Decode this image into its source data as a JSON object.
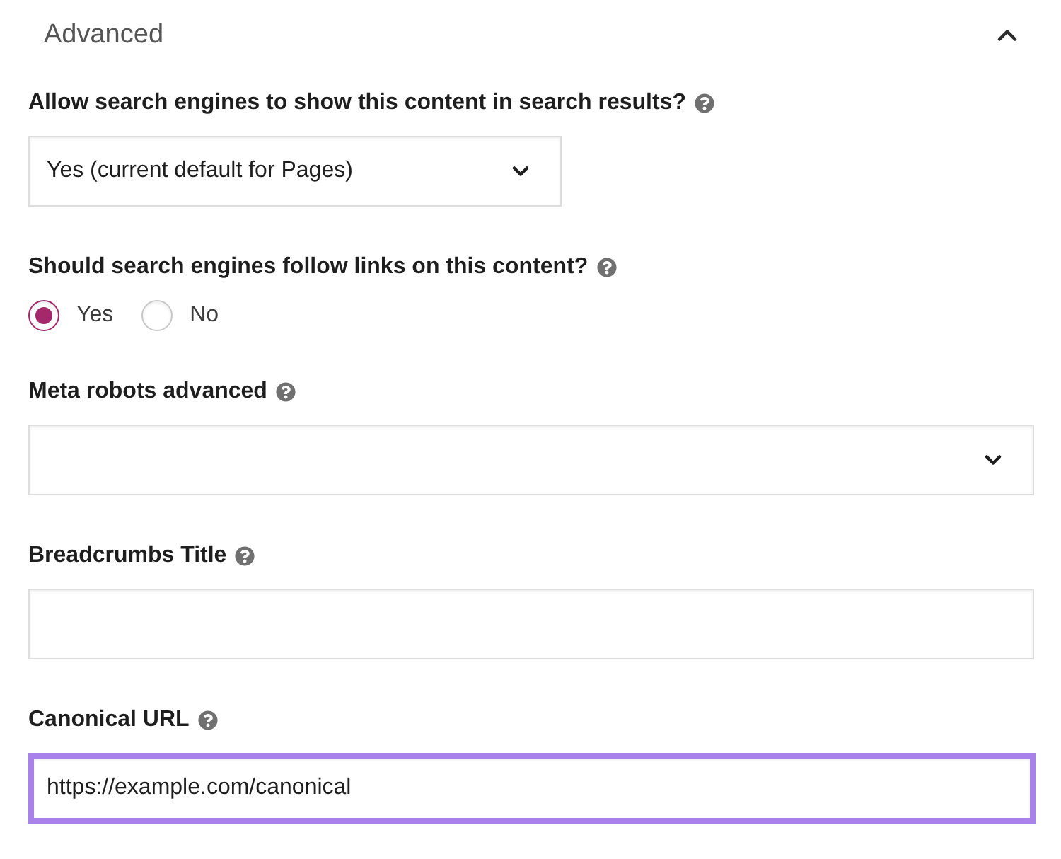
{
  "section": {
    "title": "Advanced",
    "expanded": true
  },
  "fields": [
    {
      "kind": "select",
      "label": "Allow search engines to show this content in search results?",
      "value": "Yes (current default for Pages)"
    },
    {
      "kind": "radio",
      "label": "Should search engines follow links on this content?",
      "options": [
        {
          "label": "Yes",
          "selected": true
        },
        {
          "label": "No",
          "selected": false
        }
      ]
    },
    {
      "kind": "multiselect",
      "label": "Meta robots advanced"
    },
    {
      "kind": "text",
      "label": "Breadcrumbs Title",
      "focused": false
    },
    {
      "kind": "text",
      "label": "Canonical URL",
      "value": "https://example.com/canonical",
      "focused": true
    }
  ]
}
